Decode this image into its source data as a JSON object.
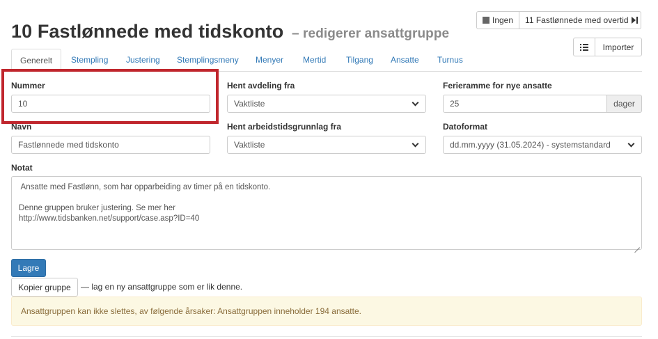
{
  "header": {
    "title": "10 Fastlønnede med tidskonto",
    "subtitle": "– redigerer ansattgruppe"
  },
  "top_nav": {
    "prev_label": "Ingen",
    "next_label": "11 Fastlønnede med overtid"
  },
  "toolbar": {
    "import_label": "Importer"
  },
  "tabs": [
    {
      "label": "Generelt",
      "active": true
    },
    {
      "label": "Stempling"
    },
    {
      "label": "Justering"
    },
    {
      "label": "Stemplingsmeny"
    },
    {
      "label": "Menyer"
    },
    {
      "label": "Mertid"
    },
    {
      "label": "Tilgang"
    },
    {
      "label": "Ansatte"
    },
    {
      "label": "Turnus"
    }
  ],
  "form": {
    "nummer": {
      "label": "Nummer",
      "value": "10"
    },
    "avdeling": {
      "label": "Hent avdeling fra",
      "value": "Vaktliste"
    },
    "ferieramme": {
      "label": "Ferieramme for nye ansatte",
      "value": "25",
      "addon": "dager"
    },
    "navn": {
      "label": "Navn",
      "value": "Fastlønnede med tidskonto"
    },
    "arbeidstid": {
      "label": "Hent arbeidstidsgrunnlag fra",
      "value": "Vaktliste"
    },
    "datoformat": {
      "label": "Datoformat",
      "value": "dd.mm.yyyy (31.05.2024) - systemstandard"
    },
    "notat": {
      "label": "Notat",
      "lines": [
        " Ansatte med Fastlønn, som har opparbeiding av timer på en tidskonto.",
        "",
        "Denne gruppen bruker justering. Se mer her",
        "http://www.tidsbanken.net/support/case.asp?ID=40"
      ]
    }
  },
  "actions": {
    "save_label": "Lagre",
    "copy_label": "Kopier gruppe",
    "copy_note": "— lag en ny ansattgruppe som er lik denne."
  },
  "alert": {
    "text": "Ansattgruppen kan ikke slettes, av følgende årsaker: Ansattgruppen inneholder 194 ansatte."
  },
  "colors": {
    "primary": "#337ab7",
    "highlight": "#c0262d",
    "alert_bg": "#fcf8e3",
    "alert_text": "#8a6d3b"
  }
}
